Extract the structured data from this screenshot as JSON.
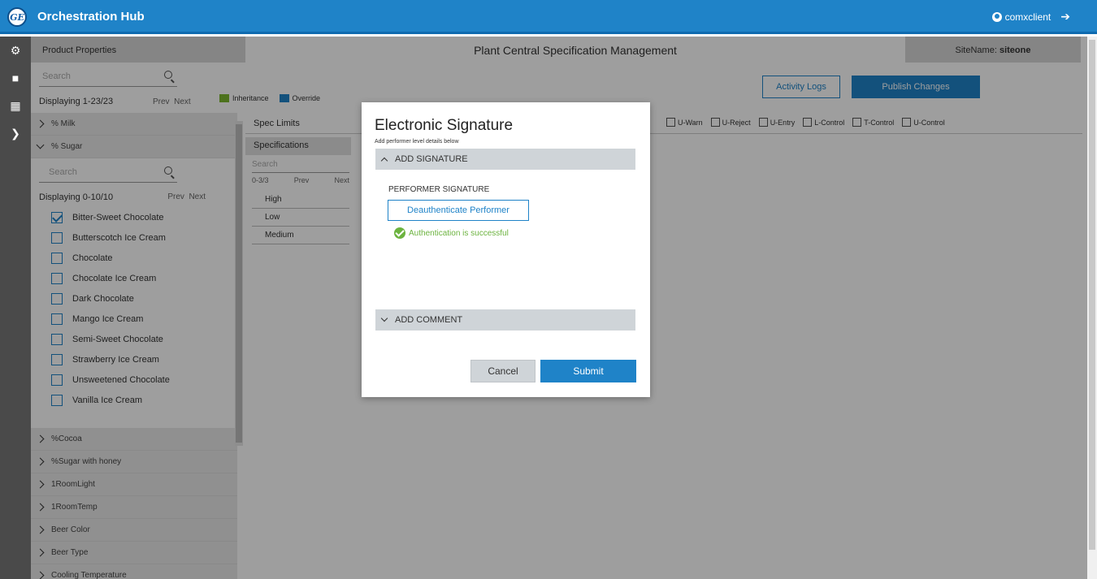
{
  "header": {
    "app_title": "Orchestration Hub",
    "logo_text": "GE",
    "user_name": "comxclient"
  },
  "rail": [
    "hierarchy-icon",
    "factory-icon",
    "grid-icon",
    "chevron-right-icon"
  ],
  "left_panel": {
    "title": "Product Properties",
    "search_placeholder": "Search",
    "displaying": "Displaying 1-23/23",
    "prev": "Prev",
    "next": "Next"
  },
  "legend": {
    "inheritance_label": "Inheritance",
    "inheritance_color": "#7cb82f",
    "override_label": "Override",
    "override_color": "#1f83c8"
  },
  "content": {
    "title": "Plant Central Specification Management",
    "site_label": "SiteName:",
    "site_value": "siteone",
    "activity_logs": "Activity Logs",
    "publish_changes": "Publish Changes"
  },
  "tree": {
    "items_top": [
      "% Milk"
    ],
    "expanded": {
      "label": "% Sugar",
      "search_placeholder": "Search",
      "displaying": "Displaying 0-10/10",
      "prev": "Prev",
      "next": "Next",
      "checkboxes": [
        {
          "label": "Bitter-Sweet Chocolate",
          "checked": true
        },
        {
          "label": "Butterscotch Ice Cream",
          "checked": false
        },
        {
          "label": "Chocolate",
          "checked": false
        },
        {
          "label": "Chocolate Ice Cream",
          "checked": false
        },
        {
          "label": "Dark Chocolate",
          "checked": false
        },
        {
          "label": "Mango Ice Cream",
          "checked": false
        },
        {
          "label": "Semi-Sweet Chocolate",
          "checked": false
        },
        {
          "label": "Strawberry Ice Cream",
          "checked": false
        },
        {
          "label": "Unsweetened Chocolate",
          "checked": false
        },
        {
          "label": "Vanilla Ice Cream",
          "checked": false
        }
      ]
    },
    "items_bottom": [
      "%Cocoa",
      "%Sugar with honey",
      "1RoomLight",
      "1RoomTemp",
      "Beer Color",
      "Beer Type",
      "Cooling Temperature"
    ]
  },
  "spec": {
    "spec_limits": "Spec Limits",
    "limit_checks": [
      "U-Warn",
      "U-Reject",
      "U-Entry",
      "L-Control",
      "T-Control",
      "U-Control"
    ],
    "specifications_tab": "Specifications",
    "search_placeholder": "Search",
    "pager_count": "0-3/3",
    "prev": "Prev",
    "next": "Next",
    "list": [
      "High",
      "Low",
      "Medium"
    ]
  },
  "modal": {
    "title": "Electronic Signature",
    "subtitle": "Add performer level details below",
    "add_signature": "ADD SIGNATURE",
    "performer_label": "PERFORMER SIGNATURE",
    "deauth_button": "Deauthenticate Performer",
    "auth_message": "Authentication is successful",
    "add_comment": "ADD COMMENT",
    "cancel": "Cancel",
    "submit": "Submit"
  }
}
